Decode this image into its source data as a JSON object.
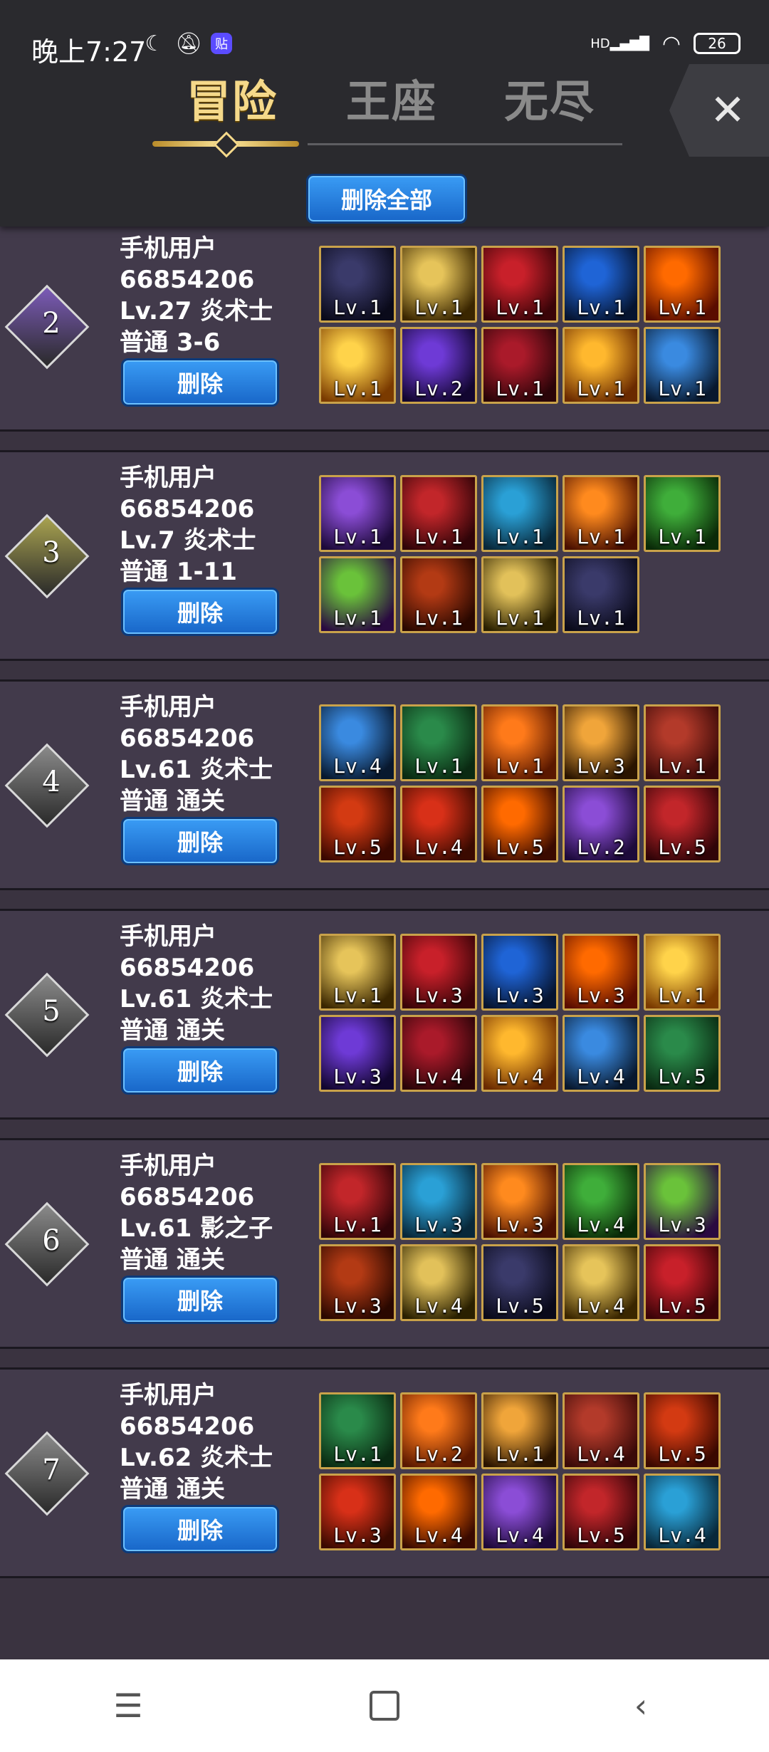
{
  "status": {
    "time": "晚上7:27",
    "battery": "26",
    "icons": [
      "moon-icon",
      "bell-off-icon",
      "app-badge-icon",
      "hd-signal-icon",
      "wifi-icon",
      "battery-icon"
    ],
    "app_badge": "贴",
    "hd": "HD"
  },
  "header": {
    "tabs": [
      "冒险",
      "王座",
      "无尽"
    ],
    "active_tab": "冒险",
    "delete_all_label": "删除全部",
    "close_label": "✕"
  },
  "rows": [
    {
      "rank": "2",
      "gem_color": "#7c5bb8",
      "user": "手机用户",
      "id": "66854206",
      "level_class": "Lv.27 炎术士",
      "stage": "普通 3-6",
      "delete_label": "删除",
      "skills": [
        "Lv.1",
        "Lv.1",
        "Lv.1",
        "Lv.1",
        "Lv.1",
        "Lv.1",
        "Lv.2",
        "Lv.1",
        "Lv.1",
        "Lv.1"
      ]
    },
    {
      "rank": "3",
      "gem_color": "#a9a350",
      "user": "手机用户",
      "id": "66854206",
      "level_class": "Lv.7 炎术士",
      "stage": "普通 1-11",
      "delete_label": "删除",
      "skills": [
        "Lv.1",
        "Lv.1",
        "Lv.1",
        "Lv.1",
        "Lv.1",
        "Lv.1",
        "Lv.1",
        "Lv.1",
        "Lv.1"
      ]
    },
    {
      "rank": "4",
      "gem_color": "#8a8a8a",
      "user": "手机用户",
      "id": "66854206",
      "level_class": "Lv.61 炎术士",
      "stage": "普通 通关",
      "delete_label": "删除",
      "skills": [
        "Lv.4",
        "Lv.1",
        "Lv.1",
        "Lv.3",
        "Lv.1",
        "Lv.5",
        "Lv.4",
        "Lv.5",
        "Lv.2",
        "Lv.5"
      ]
    },
    {
      "rank": "5",
      "gem_color": "#8a8a8a",
      "user": "手机用户",
      "id": "66854206",
      "level_class": "Lv.61 炎术士",
      "stage": "普通 通关",
      "delete_label": "删除",
      "skills": [
        "Lv.1",
        "Lv.3",
        "Lv.3",
        "Lv.3",
        "Lv.1",
        "Lv.3",
        "Lv.4",
        "Lv.4",
        "Lv.4",
        "Lv.5"
      ]
    },
    {
      "rank": "6",
      "gem_color": "#8a8a8a",
      "user": "手机用户",
      "id": "66854206",
      "level_class": "Lv.61 影之子",
      "stage": "普通 通关",
      "delete_label": "删除",
      "skills": [
        "Lv.1",
        "Lv.3",
        "Lv.3",
        "Lv.4",
        "Lv.3",
        "Lv.3",
        "Lv.4",
        "Lv.5",
        "Lv.4",
        "Lv.5"
      ]
    },
    {
      "rank": "7",
      "gem_color": "#8a8a8a",
      "user": "手机用户",
      "id": "66854206",
      "level_class": "Lv.62 炎术士",
      "stage": "普通 通关",
      "delete_label": "删除",
      "skills": [
        "Lv.1",
        "Lv.2",
        "Lv.1",
        "Lv.4",
        "Lv.5",
        "Lv.3",
        "Lv.4",
        "Lv.4",
        "Lv.5",
        "Lv.4"
      ]
    }
  ],
  "navbar": {
    "icons": [
      "menu-icon",
      "home-icon",
      "back-icon"
    ]
  }
}
